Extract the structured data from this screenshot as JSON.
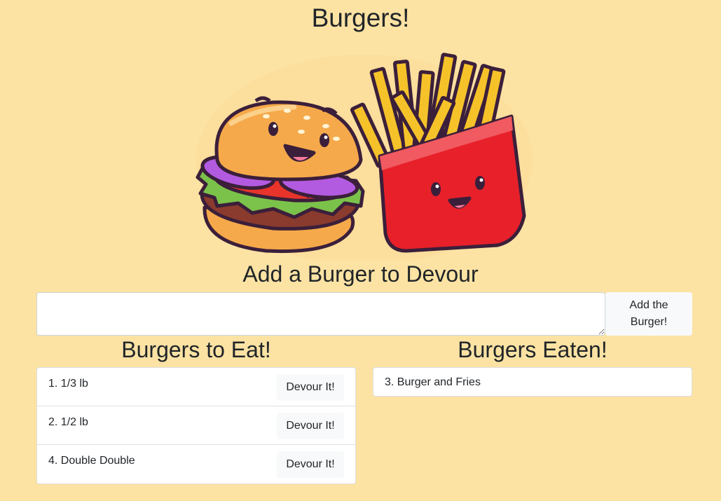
{
  "page": {
    "title": "Burgers!"
  },
  "hero": {
    "image_name": "burger-and-fries-illustration"
  },
  "form": {
    "heading": "Add a Burger to Devour",
    "input_value": "",
    "button_label": "Add the Burger!"
  },
  "to_eat": {
    "heading": "Burgers to Eat!",
    "items": [
      {
        "label": "1. 1/3 lb",
        "button": "Devour It!"
      },
      {
        "label": "2. 1/2 lb",
        "button": "Devour It!"
      },
      {
        "label": "4. Double Double",
        "button": "Devour It!"
      }
    ]
  },
  "eaten": {
    "heading": "Burgers Eaten!",
    "items": [
      {
        "label": "3. Burger and Fries"
      }
    ]
  },
  "colors": {
    "background": "#fce3a4",
    "button_bg": "#f8f9fa",
    "fries_box": "#e8202a",
    "fries": "#f6c22a",
    "bun": "#f5a94a",
    "outline": "#3b1f3a"
  }
}
